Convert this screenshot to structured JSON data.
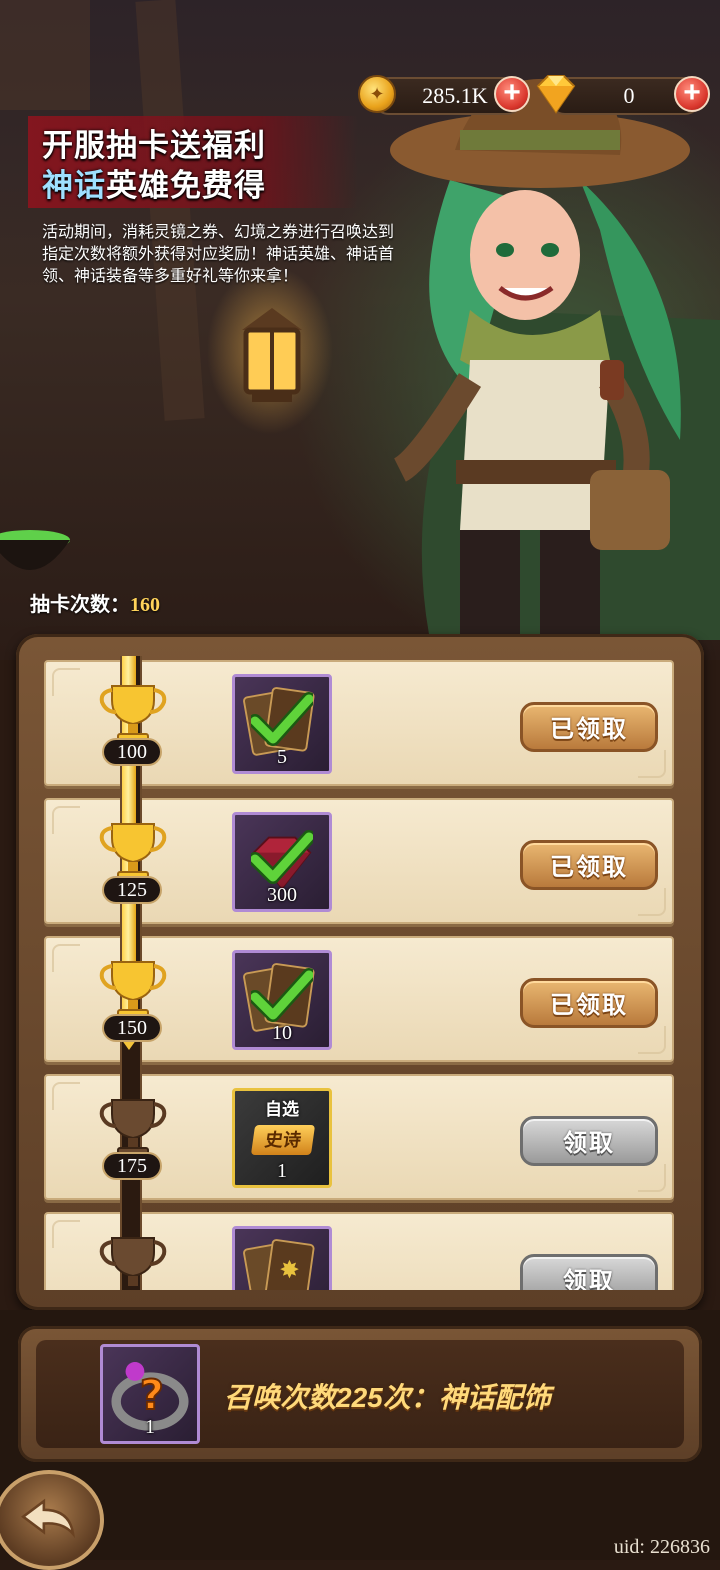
{
  "currency": {
    "coins": "285.1K",
    "gems": "0"
  },
  "event": {
    "title_line1": "开服抽卡送福利",
    "title_line2_a": "神话",
    "title_line2_b": "英雄免费得",
    "description": "活动期间，消耗灵镜之券、幻境之券进行召唤达到指定次数将额外获得对应奖励！神话英雄、神话首领、神话装备等多重好礼等你来拿！",
    "draw_count_label": "抽卡次数：",
    "draw_count_value": "160"
  },
  "milestones": [
    {
      "threshold": "100",
      "reward_icon": "card-pack-icon",
      "quantity": "5",
      "button": "已领取",
      "state": "claimed",
      "reached": true
    },
    {
      "threshold": "125",
      "reward_icon": "ruby-gem-icon",
      "quantity": "300",
      "button": "已领取",
      "state": "claimed",
      "reached": true
    },
    {
      "threshold": "150",
      "reward_icon": "card-pack-icon",
      "quantity": "10",
      "button": "已领取",
      "state": "claimed",
      "reached": true
    },
    {
      "threshold": "175",
      "reward_icon": "epic-chest-icon",
      "item_tag": "自选",
      "item_badge": "史诗",
      "quantity": "1",
      "button": "领取",
      "state": "available",
      "reached": false
    },
    {
      "threshold": "",
      "reward_icon": "card-pack-icon",
      "quantity": "",
      "button": "领取",
      "state": "available",
      "reached": false
    }
  ],
  "final_reward": {
    "text": "召唤次数225次：神话配饰",
    "quantity": "1",
    "icon": "mystery-ring-icon"
  },
  "footer": {
    "uid": "uid: 226836"
  },
  "colors": {
    "accent_gold": "#ffd35a",
    "title_accent": "#9fe0ff",
    "claimed_button": "#d49a55",
    "available_button": "#bdbdbd"
  }
}
